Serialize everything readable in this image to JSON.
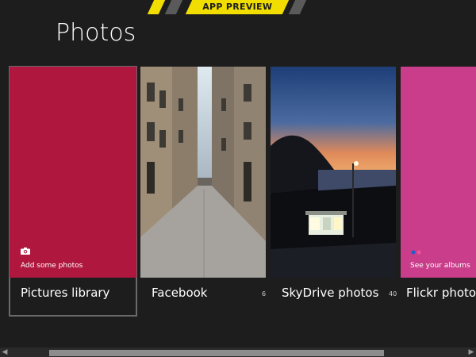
{
  "banner": {
    "label": "APP PREVIEW"
  },
  "page": {
    "title": "Photos"
  },
  "tiles": [
    {
      "label": "Pictures library",
      "overlay": "Add some photos",
      "color": "#b0173f"
    },
    {
      "label": "Facebook",
      "count": "6"
    },
    {
      "label": "SkyDrive photos",
      "count": "40"
    },
    {
      "label": "Flickr photos",
      "overlay": "See your albums",
      "color": "#c93d8a"
    }
  ],
  "colors": {
    "accent_banner": "#f2dd00",
    "background": "#1d1d1d"
  },
  "icons": {
    "camera": "camera-icon",
    "flickr": "flickr-dots-icon"
  }
}
